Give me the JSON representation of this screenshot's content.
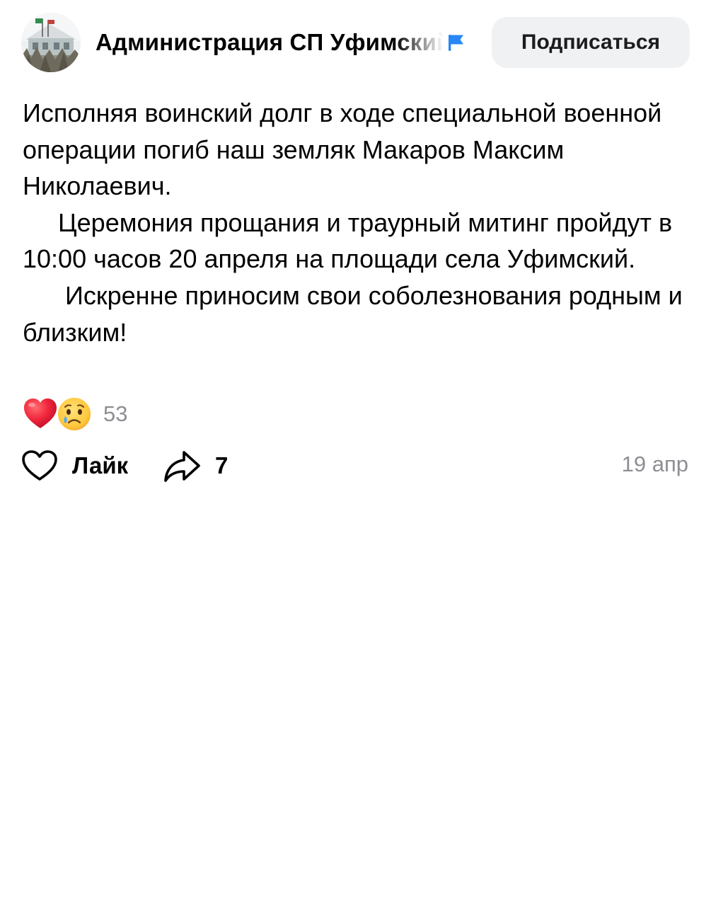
{
  "post": {
    "author": {
      "name": "Администрация СП Уфимский",
      "verified_icon": "blue-flag-icon"
    },
    "subscribe_label": "Подписаться",
    "paragraphs": [
      "Исполняя воинский долг в ходе специальной военной операции погиб наш земляк Макаров Максим Николаевич.",
      "     Церемония прощания и траурный митинг пройдут в 10:00 часов 20 апреля на площади села Уфимский.",
      "      Искренне приносим свои соболезнования родным и близким!"
    ],
    "reactions": {
      "icons": [
        "red-heart-emoji",
        "crying-face-emoji"
      ],
      "count": "53"
    },
    "actions": {
      "like_label": "Лайк",
      "like_icon": "heart-outline-icon",
      "share_icon": "share-arrow-icon",
      "share_count": "7"
    },
    "timestamp": "19 апр"
  },
  "colors": {
    "background": "#ffffff",
    "text": "#000000",
    "muted": "#8e8e93",
    "button_bg": "#f0f1f3",
    "flag": "#2787f5",
    "heart": "#ff3347"
  }
}
